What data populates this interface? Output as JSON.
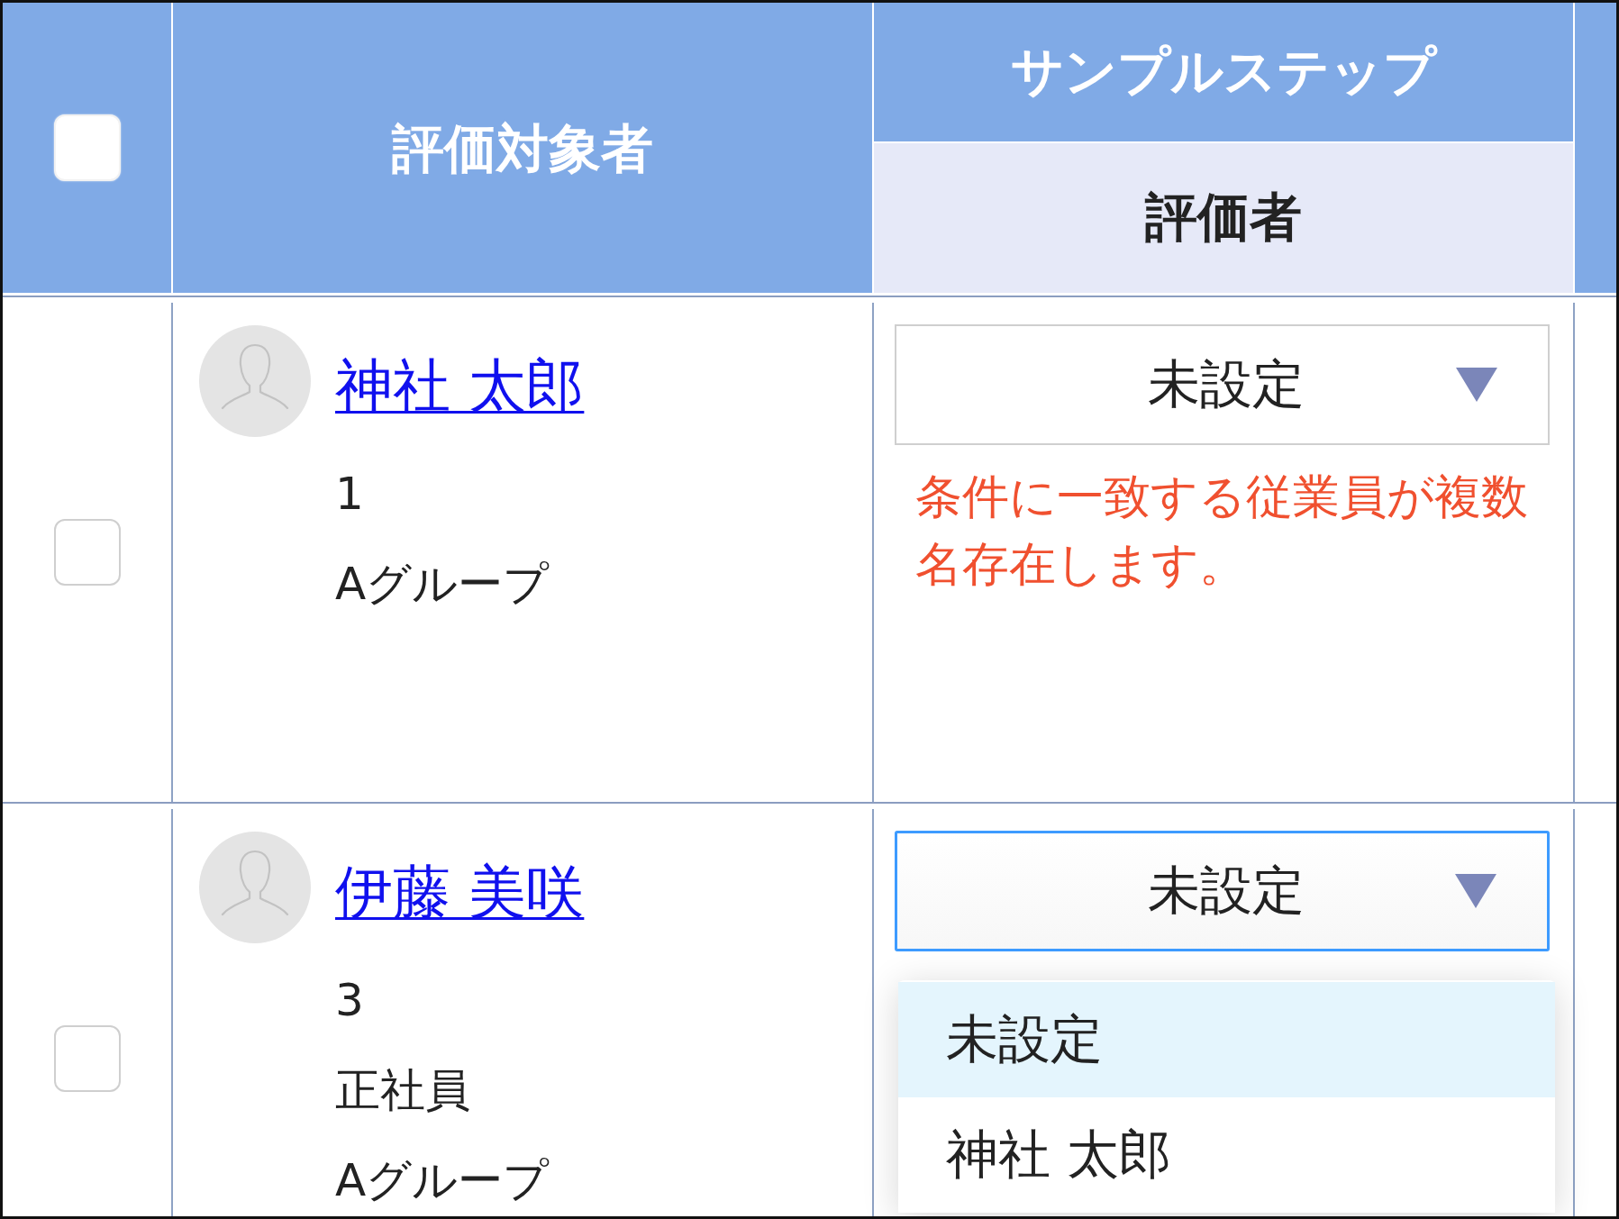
{
  "table": {
    "header": {
      "select_all": {
        "checked": false
      },
      "evaluatee_column": "評価対象者",
      "step_column": {
        "title": "サンプルステップ",
        "subcolumn": "評価者"
      }
    },
    "rows": [
      {
        "checked": false,
        "name": "神社 太郎",
        "details": [
          "1",
          "Aグループ"
        ],
        "evaluator_select": {
          "value": "未設定",
          "expanded": false
        },
        "message": "条件に一致する従業員が複数名存在します。"
      },
      {
        "checked": false,
        "name": "伊藤 美咲",
        "details": [
          "3",
          "正社員",
          "Aグループ"
        ],
        "evaluator_select": {
          "value": "未設定",
          "expanded": true,
          "options": [
            {
              "label": "未設定",
              "selected": true
            },
            {
              "label": "神社 太郎",
              "selected": false
            }
          ]
        }
      }
    ]
  }
}
